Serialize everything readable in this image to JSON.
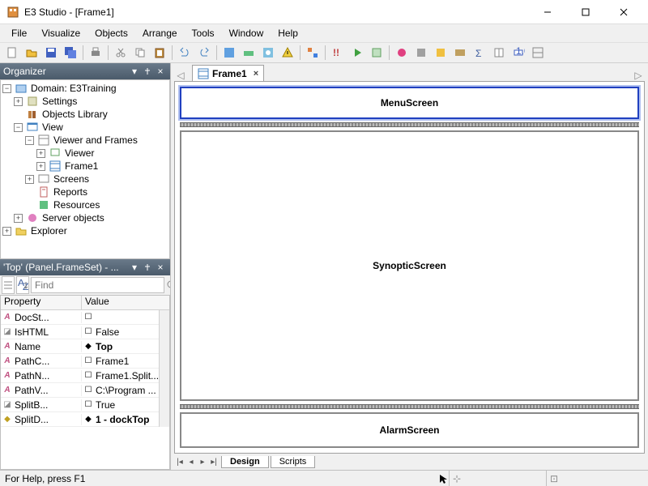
{
  "title": "E3 Studio - [Frame1]",
  "menu": [
    "File",
    "Visualize",
    "Objects",
    "Arrange",
    "Tools",
    "Window",
    "Help"
  ],
  "organizer": {
    "title": "Organizer",
    "nodes": {
      "domain": "Domain: E3Training",
      "settings": "Settings",
      "objlib": "Objects Library",
      "view": "View",
      "viewerframes": "Viewer and Frames",
      "viewer": "Viewer",
      "frame1": "Frame1",
      "screens": "Screens",
      "reports": "Reports",
      "resources": "Resources",
      "serverobj": "Server objects",
      "explorer": "Explorer"
    }
  },
  "props": {
    "title": "'Top' (Panel.FrameSet) - ...",
    "find_placeholder": "Find",
    "headers": {
      "prop": "Property",
      "val": "Value"
    },
    "rows": [
      {
        "p": "DocSt...",
        "v": "",
        "icon": "a"
      },
      {
        "p": "IsHTML",
        "v": "False",
        "icon": "b"
      },
      {
        "p": "Name",
        "v": "Top",
        "icon": "a",
        "bold": true
      },
      {
        "p": "PathC...",
        "v": "Frame1",
        "icon": "a"
      },
      {
        "p": "PathN...",
        "v": "Frame1.Split...",
        "icon": "a"
      },
      {
        "p": "PathV...",
        "v": "C:\\Program ...",
        "icon": "a"
      },
      {
        "p": "SplitB...",
        "v": "True",
        "icon": "b"
      },
      {
        "p": "SplitD...",
        "v": "1 - dockTop",
        "icon": "c",
        "bold": true
      }
    ]
  },
  "editor": {
    "tab": "Frame1",
    "frames": {
      "menu": "MenuScreen",
      "syn": "SynopticScreen",
      "alarm": "AlarmScreen"
    },
    "bottomtabs": [
      "Design",
      "Scripts"
    ]
  },
  "status": "For Help, press F1"
}
